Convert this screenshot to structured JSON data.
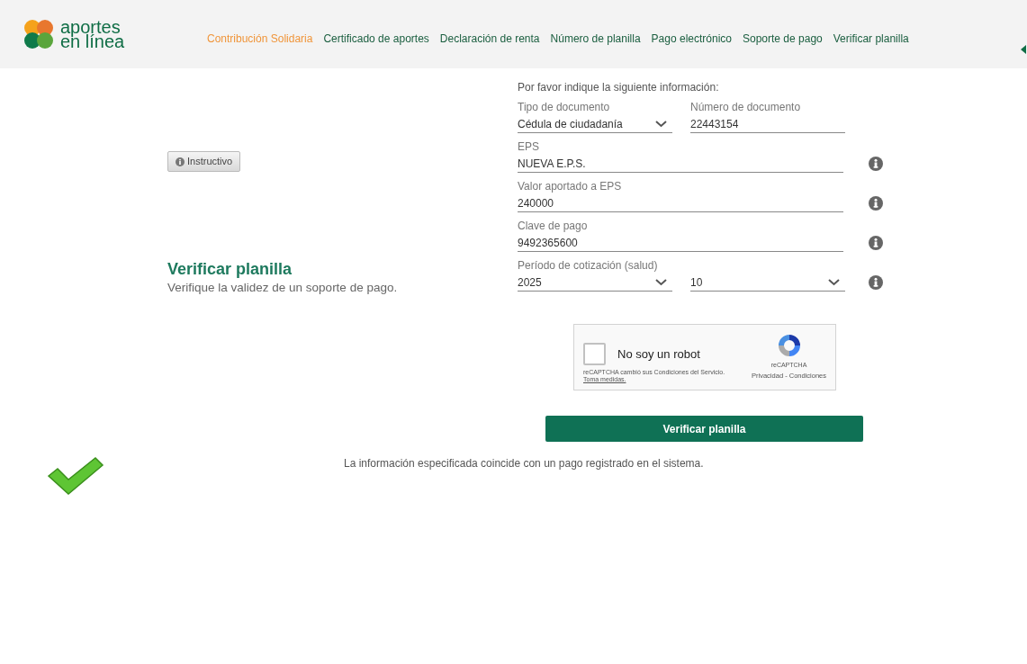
{
  "logo": {
    "line_1": "aportes",
    "line_2": "en línea"
  },
  "nav": [
    {
      "label": "Contribución Solidaria",
      "selected": true
    },
    {
      "label": "Certificado de aportes",
      "selected": false
    },
    {
      "label": "Declaración de renta",
      "selected": false
    },
    {
      "label": "Número de planilla",
      "selected": false
    },
    {
      "label": "Pago electrónico",
      "selected": false
    },
    {
      "label": "Soporte de pago",
      "selected": false
    },
    {
      "label": "Verificar planilla",
      "selected": false
    }
  ],
  "instructivo_button": "Instructivo",
  "page_title": "Verificar planilla",
  "page_subtitle": "Verifique la validez de un soporte de pago.",
  "form": {
    "heading": "Por favor indique la siguiente información:",
    "rows": [
      {
        "info": false,
        "fields": [
          {
            "kind": "select",
            "label": "Tipo de documento",
            "value": "Cédula de ciudadanía"
          },
          {
            "kind": "text",
            "label": "Número de documento",
            "value": "22443154"
          }
        ]
      },
      {
        "info": true,
        "fields": [
          {
            "kind": "text",
            "label": "EPS",
            "value": "NUEVA E.P.S."
          }
        ]
      },
      {
        "info": true,
        "fields": [
          {
            "kind": "text",
            "label": "Valor aportado a EPS",
            "value": "240000"
          }
        ]
      },
      {
        "info": true,
        "fields": [
          {
            "kind": "text",
            "label": "Clave de pago",
            "value": "9492365600"
          }
        ]
      },
      {
        "info": true,
        "label": "Período de cotización (salud)",
        "fields": [
          {
            "kind": "select",
            "value": "2025"
          },
          {
            "kind": "select",
            "value": "10"
          }
        ]
      }
    ]
  },
  "captcha": {
    "label": "No soy un robot",
    "checked": false,
    "notice": "reCAPTCHA cambió sus Condiciones del Servicio.",
    "notice_link": "Toma medidas.",
    "brand": "reCAPTCHA",
    "links": "Privacidad - Condiciones"
  },
  "submit_button": "Verificar planilla",
  "result_message": "La información especificada coincide con un pago registrado en el sistema."
}
